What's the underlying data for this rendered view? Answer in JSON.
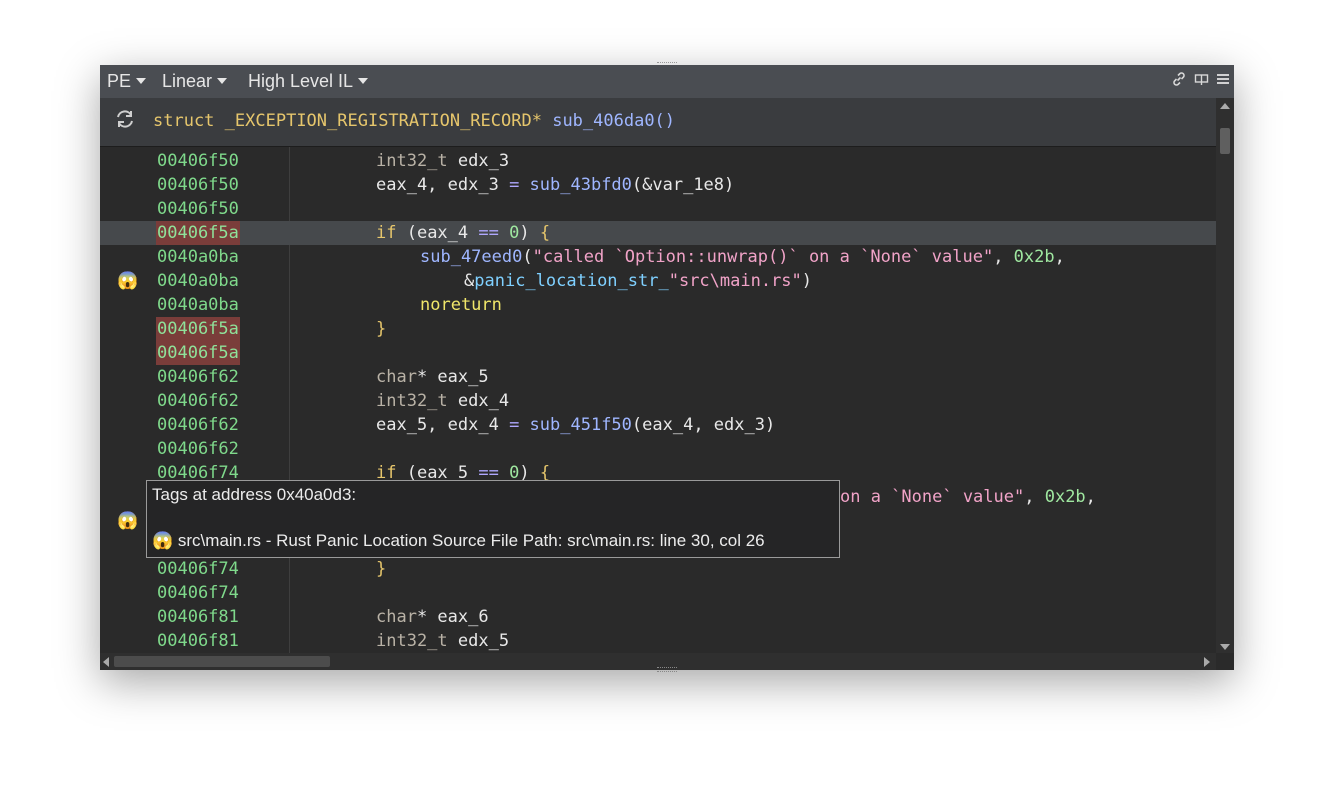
{
  "toolbar": {
    "view_type": "PE",
    "view_mode": "Linear",
    "il_level": "High Level IL"
  },
  "icons": {
    "link": "link-icon",
    "split": "split-view-icon",
    "menu": "hamburger-menu-icon",
    "refresh": "refresh-icon",
    "tag": "screaming-face-emoji"
  },
  "header": {
    "kw": "struct",
    "type": "_EXCEPTION_REGISTRATION_RECORD*",
    "func": "sub_406da0()"
  },
  "rows": [
    {
      "addr": "00406f50",
      "tokens": [
        [
          "int32_t ",
          "t-type"
        ],
        [
          "edx_3",
          "t-var"
        ]
      ]
    },
    {
      "addr": "00406f50",
      "tokens": [
        [
          "eax_4, edx_3 ",
          "t-var"
        ],
        [
          "= ",
          "t-op"
        ],
        [
          "sub_43bfd0",
          "t-fn"
        ],
        [
          "(&var_1e8)",
          "t-var"
        ]
      ]
    },
    {
      "addr": "00406f50",
      "tokens": []
    },
    {
      "addr": "00406f5a",
      "tokens": [
        [
          "if ",
          "t-kw"
        ],
        [
          "(eax_4 ",
          "t-var"
        ],
        [
          "== ",
          "t-op"
        ],
        [
          "0",
          "t-num"
        ],
        [
          ") ",
          "t-var"
        ],
        [
          "{",
          "t-brace"
        ]
      ]
    },
    {
      "addr": "0040a0ba",
      "tokens": [
        [
          "sub_47eed0",
          "t-fn"
        ],
        [
          "(",
          "t-var"
        ],
        [
          "\"called `Option::unwrap()` on a `None` value\"",
          "t-str"
        ],
        [
          ", ",
          "t-var"
        ],
        [
          "0x2b",
          "t-num"
        ],
        [
          ",",
          "t-var"
        ]
      ]
    },
    {
      "addr": "0040a0ba",
      "tokens": [
        [
          "&",
          "t-var"
        ],
        [
          "panic_location_str_",
          "t-sym"
        ],
        [
          "\"src\\main.rs\"",
          "t-str"
        ],
        [
          ")",
          "t-var"
        ]
      ]
    },
    {
      "addr": "0040a0ba",
      "tokens": [
        [
          "noreturn",
          "t-ret"
        ]
      ]
    },
    {
      "addr": "00406f5a",
      "tokens": [
        [
          "}",
          "t-brace"
        ]
      ]
    },
    {
      "addr": "00406f5a",
      "tokens": []
    },
    {
      "addr": "00406f62",
      "tokens": [
        [
          "char",
          "t-type"
        ],
        [
          "* eax_5",
          "t-var"
        ]
      ]
    },
    {
      "addr": "00406f62",
      "tokens": [
        [
          "int32_t ",
          "t-type"
        ],
        [
          "edx_4",
          "t-var"
        ]
      ]
    },
    {
      "addr": "00406f62",
      "tokens": [
        [
          "eax_5, edx_4 ",
          "t-var"
        ],
        [
          "= ",
          "t-op"
        ],
        [
          "sub_451f50",
          "t-fn"
        ],
        [
          "(eax_4, edx_3)",
          "t-var"
        ]
      ]
    },
    {
      "addr": "00406f62",
      "tokens": []
    },
    {
      "addr": "00406f74",
      "tokens": [
        [
          "if ",
          "t-kw"
        ],
        [
          "(eax_5 ",
          "t-var"
        ],
        [
          "== ",
          "t-op"
        ],
        [
          "0",
          "t-num"
        ],
        [
          ") ",
          "t-var"
        ],
        [
          "{",
          "t-brace"
        ]
      ]
    },
    {
      "addr": "",
      "tokens": [
        [
          "on a `None` value\"",
          "t-str"
        ],
        [
          ", ",
          "t-var"
        ],
        [
          "0x2b",
          "t-num"
        ],
        [
          ",",
          "t-var"
        ]
      ]
    },
    {
      "addr": "",
      "tokens": []
    },
    {
      "addr": "",
      "tokens": []
    },
    {
      "addr": "00406f74",
      "tokens": [
        [
          "}",
          "t-brace"
        ]
      ]
    },
    {
      "addr": "00406f74",
      "tokens": []
    },
    {
      "addr": "00406f81",
      "tokens": [
        [
          "char",
          "t-type"
        ],
        [
          "* eax_6",
          "t-var"
        ]
      ]
    },
    {
      "addr": "00406f81",
      "tokens": [
        [
          "int32_t ",
          "t-type"
        ],
        [
          "edx_5",
          "t-var"
        ]
      ]
    }
  ],
  "tooltip": {
    "title": "Tags at address 0x40a0d3:",
    "emoji": "😱",
    "line": " src\\main.rs - Rust Panic Location Source File Path: src\\main.rs: line 30, col 26"
  },
  "colors": {
    "address": "#7fd98b",
    "highlight_row": "#46494c",
    "tagged_address_bg": "#7a3d3a",
    "toolbar": "#4a4d52"
  }
}
